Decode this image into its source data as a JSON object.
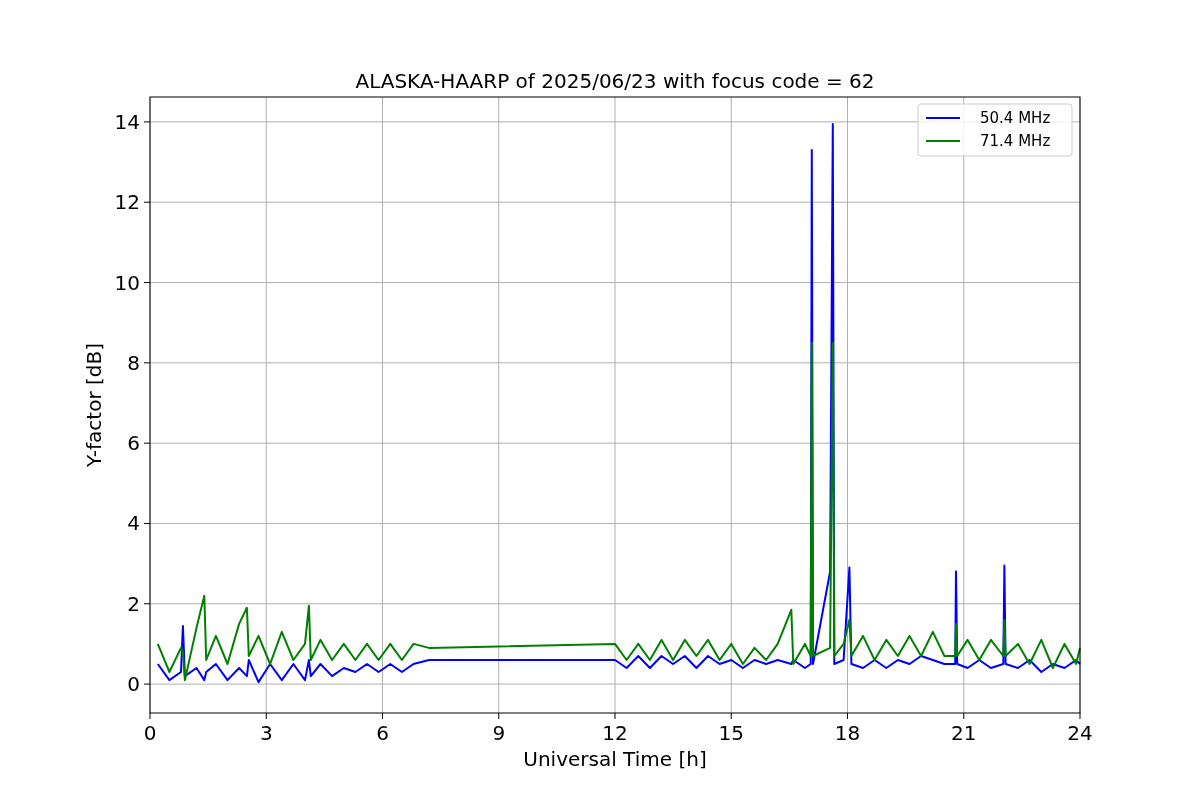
{
  "figure": {
    "chart_data": {
      "type": "line",
      "title": "ALASKA-HAARP of 2025/06/23 with focus code = 62",
      "xlabel": "Universal Time [h]",
      "ylabel": "Y-factor [dB]",
      "grid": true,
      "legend": true,
      "xlim": [
        0,
        24
      ],
      "ylim": [
        -0.72,
        14.62
      ],
      "xticks": [
        0,
        3,
        6,
        9,
        12,
        15,
        18,
        21,
        24
      ],
      "yticks": [
        0,
        2,
        4,
        6,
        8,
        10,
        12,
        14
      ],
      "x": [
        0.2,
        0.5,
        0.8,
        0.85,
        0.9,
        1.2,
        1.4,
        1.45,
        1.7,
        2.0,
        2.3,
        2.5,
        2.55,
        2.8,
        3.1,
        3.4,
        3.7,
        4.0,
        4.1,
        4.15,
        4.4,
        4.7,
        5.0,
        5.3,
        5.6,
        5.9,
        6.2,
        6.5,
        6.8,
        7.2,
        12.0,
        12.3,
        12.6,
        12.9,
        13.2,
        13.5,
        13.8,
        14.1,
        14.4,
        14.7,
        15.0,
        15.3,
        15.6,
        15.9,
        16.2,
        16.55,
        16.6,
        16.9,
        17.05,
        17.08,
        17.11,
        17.55,
        17.62,
        17.66,
        17.9,
        18.05,
        18.1,
        18.4,
        18.7,
        19.0,
        19.3,
        19.6,
        19.9,
        20.2,
        20.5,
        20.78,
        20.8,
        20.83,
        21.1,
        21.4,
        21.7,
        22.02,
        22.05,
        22.08,
        22.4,
        22.7,
        23.0,
        23.3,
        23.6,
        23.9,
        24.0
      ],
      "series": [
        {
          "name": "50.4 MHz",
          "color": "#0000ff",
          "values": [
            0.5,
            0.1,
            0.3,
            1.45,
            0.2,
            0.4,
            0.1,
            0.3,
            0.5,
            0.1,
            0.4,
            0.2,
            0.6,
            0.05,
            0.5,
            0.1,
            0.5,
            0.1,
            0.6,
            0.2,
            0.5,
            0.2,
            0.4,
            0.3,
            0.5,
            0.3,
            0.5,
            0.3,
            0.5,
            0.6,
            0.6,
            0.4,
            0.7,
            0.4,
            0.7,
            0.5,
            0.7,
            0.4,
            0.7,
            0.5,
            0.6,
            0.4,
            0.6,
            0.5,
            0.6,
            0.5,
            0.6,
            0.4,
            0.5,
            13.3,
            0.5,
            2.8,
            13.95,
            0.5,
            0.6,
            2.9,
            0.5,
            0.4,
            0.6,
            0.4,
            0.6,
            0.5,
            0.7,
            0.6,
            0.5,
            0.5,
            2.8,
            0.5,
            0.4,
            0.6,
            0.4,
            0.5,
            2.95,
            0.5,
            0.4,
            0.6,
            0.3,
            0.5,
            0.4,
            0.6,
            0.5
          ]
        },
        {
          "name": "71.4 MHz",
          "color": "#008000",
          "values": [
            1.0,
            0.3,
            0.9,
            0.8,
            0.1,
            1.4,
            2.2,
            0.6,
            1.2,
            0.5,
            1.5,
            1.9,
            0.7,
            1.2,
            0.5,
            1.3,
            0.6,
            1.0,
            1.95,
            0.6,
            1.1,
            0.6,
            1.0,
            0.6,
            1.0,
            0.6,
            1.0,
            0.6,
            1.0,
            0.9,
            1.0,
            0.6,
            1.0,
            0.6,
            1.1,
            0.6,
            1.1,
            0.7,
            1.1,
            0.6,
            1.0,
            0.5,
            0.9,
            0.6,
            1.0,
            1.85,
            0.5,
            1.0,
            0.7,
            8.5,
            0.7,
            0.9,
            8.5,
            0.7,
            1.0,
            1.6,
            0.7,
            1.2,
            0.6,
            1.1,
            0.7,
            1.2,
            0.7,
            1.3,
            0.7,
            0.7,
            1.5,
            0.7,
            1.1,
            0.6,
            1.1,
            0.7,
            1.6,
            0.7,
            1.0,
            0.5,
            1.1,
            0.4,
            1.0,
            0.5,
            0.9
          ]
        }
      ]
    }
  }
}
